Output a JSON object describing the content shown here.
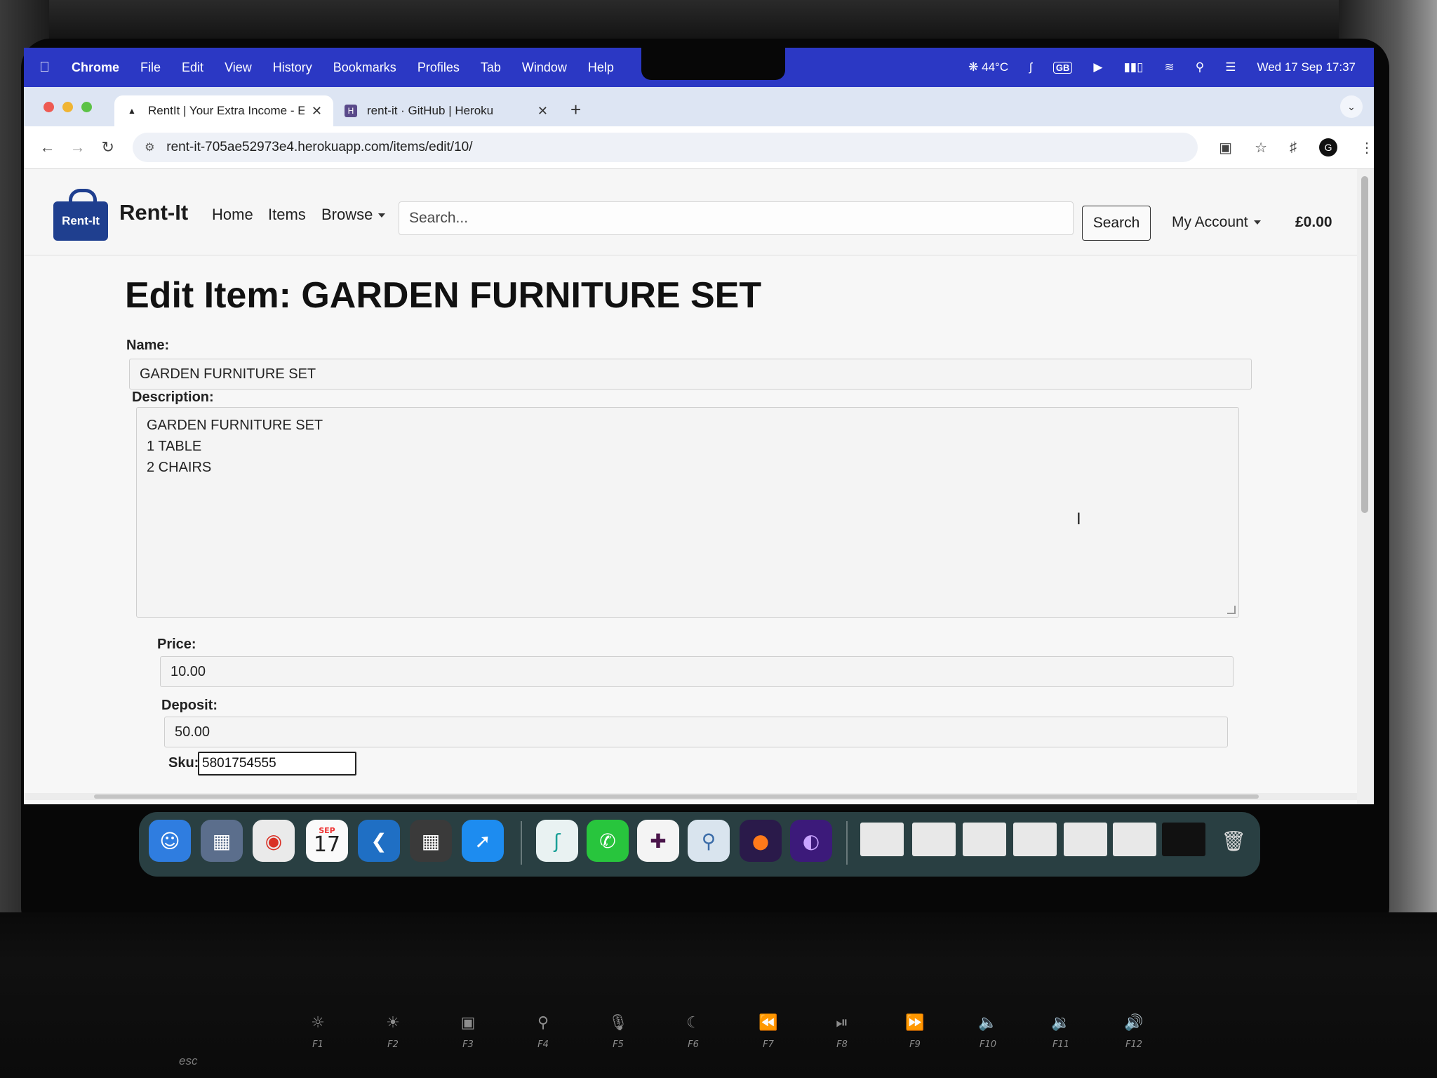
{
  "menubar": {
    "app": "Chrome",
    "items": [
      "File",
      "Edit",
      "View",
      "History",
      "Bookmarks",
      "Profiles",
      "Tab",
      "Window",
      "Help"
    ],
    "temperature": "44°C",
    "keyboard_layout": "GB",
    "datetime": "Wed 17 Sep  17:37"
  },
  "tabs": [
    {
      "title": "RentIt | Your Extra Income - E",
      "active": true
    },
    {
      "title": "rent-it · GitHub | Heroku",
      "active": false
    }
  ],
  "toolbar": {
    "url": "rent-it-705ae52973e4.herokuapp.com/items/edit/10/",
    "profile_initial": "G"
  },
  "site": {
    "logo_text": "Rent-It",
    "brand": "Rent-It",
    "nav": {
      "home": "Home",
      "items": "Items",
      "browse": "Browse"
    },
    "search_placeholder": "Search...",
    "search_button": "Search",
    "account": "My Account",
    "cart_total": "£0.00"
  },
  "form": {
    "title": "Edit Item: GARDEN FURNITURE SET",
    "name_label": "Name:",
    "name_value": "GARDEN FURNITURE SET",
    "description_label": "Description:",
    "description_lines": [
      "GARDEN FURNITURE SET",
      "1 TABLE",
      "2 CHAIRS"
    ],
    "price_label": "Price:",
    "price_value": "10.00",
    "deposit_label": "Deposit:",
    "deposit_value": "50.00",
    "sku_label": "Sku:",
    "sku_value": "5801754555"
  },
  "dock": {
    "calendar_month": "SEP",
    "calendar_day": "17",
    "apps": [
      "finder-icon",
      "launchpad-icon",
      "chrome-icon",
      "calendar-icon",
      "vscode-icon",
      "calculator-icon",
      "safari-icon",
      "surfshark-icon",
      "whatsapp-icon",
      "slack-icon",
      "keychain-icon",
      "firefox-icon",
      "tor-icon",
      "trash-icon"
    ]
  },
  "function_keys": {
    "esc": "esc",
    "labels": [
      "F1",
      "F2",
      "F3",
      "F4",
      "F5",
      "F6",
      "F7",
      "F8",
      "F9",
      "F10",
      "F11",
      "F12"
    ]
  }
}
